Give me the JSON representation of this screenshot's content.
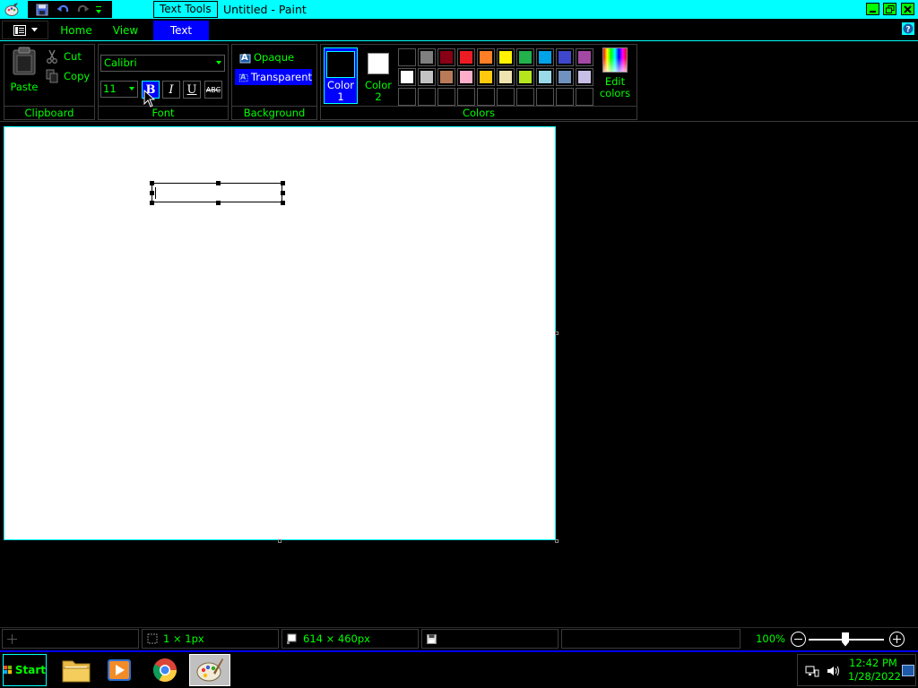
{
  "titlebar": {
    "context_label": "Text Tools",
    "window_title": "Untitled - Paint"
  },
  "tabs": {
    "home": "Home",
    "view": "View",
    "text": "Text"
  },
  "ribbon": {
    "clipboard": {
      "paste": "Paste",
      "cut": "Cut",
      "copy": "Copy",
      "label": "Clipboard"
    },
    "font": {
      "family": "Calibri",
      "size": "11",
      "bold": "B",
      "italic": "I",
      "underline": "U",
      "strikethrough": "ABC",
      "label": "Font"
    },
    "background": {
      "opaque": "Opaque",
      "transparent": "Transparent",
      "label": "Background"
    },
    "colors": {
      "color1_line1": "Color",
      "color1_line2": "1",
      "color2_line1": "Color",
      "color2_line2": "2",
      "edit_line1": "Edit",
      "edit_line2": "colors",
      "label": "Colors",
      "color1": "#000000",
      "color2": "#ffffff",
      "palette": [
        "#000000",
        "#7f7f7f",
        "#880015",
        "#ed1c24",
        "#ff7f27",
        "#fff200",
        "#22b14c",
        "#00a2e8",
        "#3f48cc",
        "#a349a4",
        "#ffffff",
        "#c3c3c3",
        "#b97a57",
        "#ffaec9",
        "#ffc90e",
        "#efe4b0",
        "#b5e61d",
        "#99d9ea",
        "#7092be",
        "#c8bfe7",
        "",
        "",
        "",
        "",
        "",
        "",
        "",
        "",
        "",
        ""
      ]
    }
  },
  "statusbar": {
    "selection_size": "1 × 1px",
    "image_size": "614 × 460px",
    "zoom": "100%",
    "zoom_percent": 100
  },
  "taskbar": {
    "start": "Start",
    "time": "12:42 PM",
    "date": "1/28/2022"
  },
  "theme": {
    "accent": "#00ffff",
    "text": "#00ff00",
    "selected": "#0000ff"
  }
}
